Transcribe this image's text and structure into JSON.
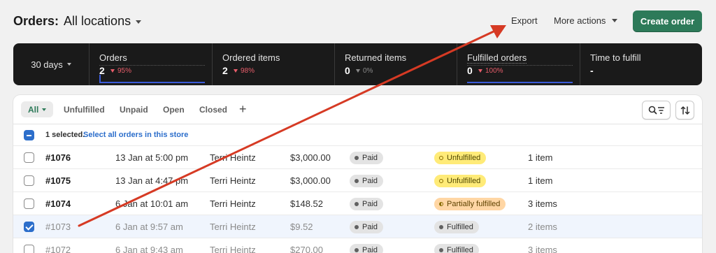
{
  "header": {
    "title": "Orders:",
    "location": "All locations",
    "export_label": "Export",
    "more_actions_label": "More actions",
    "create_order_label": "Create order"
  },
  "stats": {
    "period": "30 days",
    "items": [
      {
        "label": "Orders",
        "value": "2",
        "delta": "95%",
        "trend": "down",
        "color": "#e85d6a"
      },
      {
        "label": "Ordered items",
        "value": "2",
        "delta": "98%",
        "trend": "down",
        "color": "#e85d6a"
      },
      {
        "label": "Returned items",
        "value": "0",
        "delta": "0%",
        "trend": "flat",
        "color": "#8a8a8a"
      },
      {
        "label": "Fulfilled orders",
        "value": "0",
        "delta": "100%",
        "trend": "down",
        "color": "#e85d6a"
      },
      {
        "label": "Time to fulfill",
        "value": "-",
        "delta": "",
        "trend": "none",
        "color": ""
      }
    ]
  },
  "tabs": [
    "All",
    "Unfulfilled",
    "Unpaid",
    "Open",
    "Closed"
  ],
  "selection": {
    "count_text": "1 selected.",
    "select_all_text": "Select all orders in this store"
  },
  "orders": [
    {
      "order": "#1076",
      "date": "13 Jan at 5:00 pm",
      "customer": "Terri Heintz",
      "total": "$3,000.00",
      "payment": "Paid",
      "fulfillment": "Unfulfilled",
      "items": "1 item"
    },
    {
      "order": "#1075",
      "date": "13 Jan at 4:47 pm",
      "customer": "Terri Heintz",
      "total": "$3,000.00",
      "payment": "Paid",
      "fulfillment": "Unfulfilled",
      "items": "1 item"
    },
    {
      "order": "#1074",
      "date": "6 Jan at 10:01 am",
      "customer": "Terri Heintz",
      "total": "$148.52",
      "payment": "Paid",
      "fulfillment": "Partially fulfilled",
      "items": "3 items"
    },
    {
      "order": "#1073",
      "date": "6 Jan at 9:57 am",
      "customer": "Terri Heintz",
      "total": "$9.52",
      "payment": "Paid",
      "fulfillment": "Fulfilled",
      "items": "2 items"
    },
    {
      "order": "#1072",
      "date": "6 Jan at 9:43 am",
      "customer": "Terri Heintz",
      "total": "$270.00",
      "payment": "Paid",
      "fulfillment": "Fulfilled",
      "items": "3 items"
    }
  ],
  "colors": {
    "primary": "#2d7a59",
    "link": "#2c6ecb",
    "annotation_arrow": "#d63a24"
  }
}
